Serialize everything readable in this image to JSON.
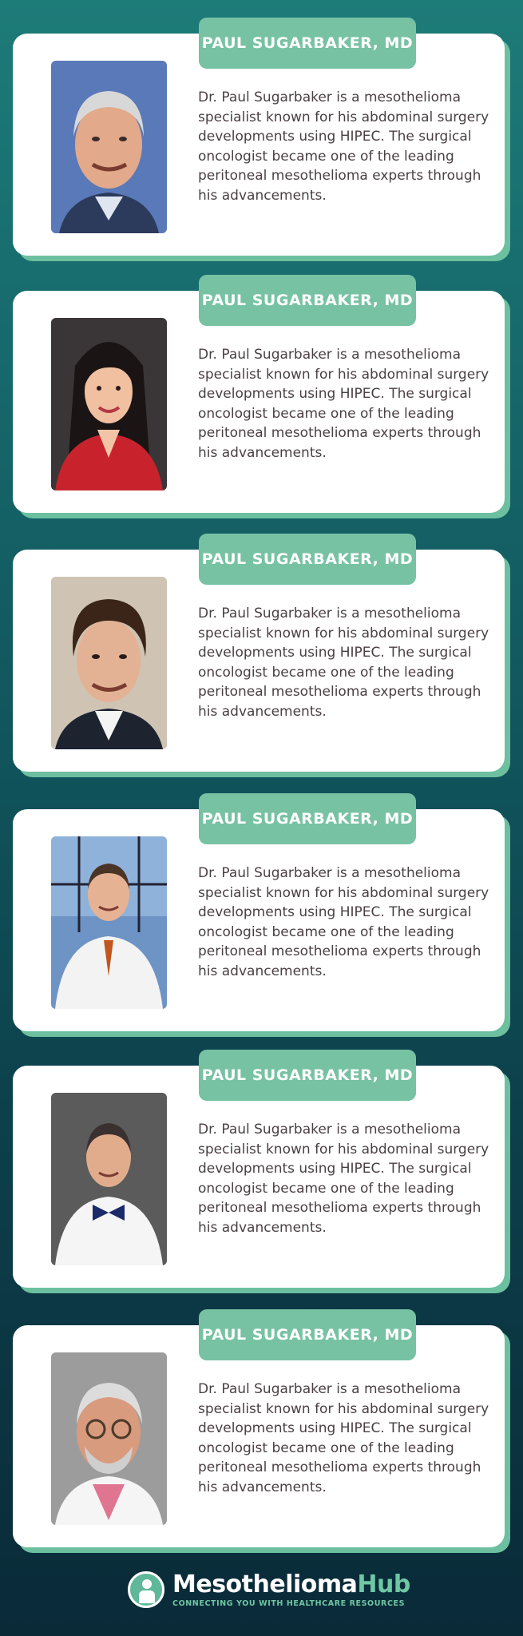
{
  "cards": [
    {
      "name": "PAUL SUGARBAKER, MD",
      "bio": "Dr. Paul Sugarbaker is a mesothelioma specialist known for his abdominal surgery developments using HIPEC. The surgical oncologist became one of the leading peritoneal mesothelioma experts through his advancements."
    },
    {
      "name": "PAUL SUGARBAKER, MD",
      "bio": "Dr. Paul Sugarbaker is a mesothelioma specialist known for his abdominal surgery developments using HIPEC. The surgical oncologist became one of the leading peritoneal mesothelioma experts through his advancements."
    },
    {
      "name": "PAUL SUGARBAKER, MD",
      "bio": "Dr. Paul Sugarbaker is a mesothelioma specialist known for his abdominal surgery developments using HIPEC. The surgical oncologist became one of the leading peritoneal mesothelioma experts through his advancements."
    },
    {
      "name": "PAUL SUGARBAKER, MD",
      "bio": "Dr. Paul Sugarbaker is a mesothelioma specialist known for his abdominal surgery developments using HIPEC. The surgical oncologist became one of the leading peritoneal mesothelioma experts through his advancements."
    },
    {
      "name": "PAUL SUGARBAKER, MD",
      "bio": "Dr. Paul Sugarbaker is a mesothelioma specialist known for his abdominal surgery developments using HIPEC. The surgical oncologist became one of the leading peritoneal mesothelioma experts through his advancements."
    },
    {
      "name": "PAUL SUGARBAKER, MD",
      "bio": "Dr. Paul Sugarbaker is a mesothelioma specialist known for his abdominal surgery developments using HIPEC. The surgical oncologist became one of the leading peritoneal mesothelioma experts through his advancements."
    }
  ],
  "footer": {
    "logo_name_a": "Mesothelioma",
    "logo_name_b": "Hub",
    "tagline": "CONNECTING YOU WITH HEALTHCARE RESOURCES"
  },
  "colors": {
    "badge": "#77c2a3",
    "card_shadow": "#6cc0a0",
    "background_top": "#1d7b78",
    "background_bottom": "#0a2a38"
  }
}
